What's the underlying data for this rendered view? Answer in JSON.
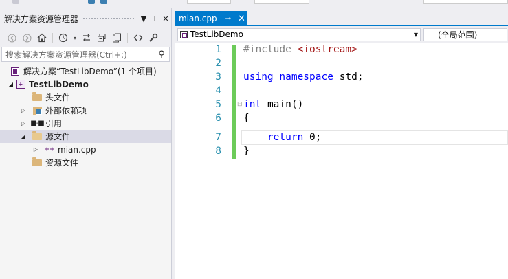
{
  "solution_explorer": {
    "title": "解决方案资源管理器",
    "title_buttons": [
      "▼",
      "⊥",
      "✕"
    ],
    "toolbar_icons": [
      "back-icon",
      "forward-icon",
      "home-icon",
      "history-icon",
      "sync-icon",
      "collapse-icon",
      "show-all-icon",
      "code-icon",
      "properties-icon"
    ],
    "search_placeholder": "搜索解决方案资源管理器(Ctrl+;)",
    "tree": [
      {
        "label": "解决方案“TestLibDemo”(1 个项目)",
        "level": 0,
        "icon": "solution-icon",
        "expand": ""
      },
      {
        "label": "TestLibDemo",
        "level": 0,
        "icon": "project-icon",
        "expand": "◢",
        "bold": true
      },
      {
        "label": "头文件",
        "level": 1,
        "icon": "folder-icon",
        "expand": ""
      },
      {
        "label": "外部依赖项",
        "level": 1,
        "icon": "external-deps-icon",
        "expand": "▷"
      },
      {
        "label": "引用",
        "level": 1,
        "icon": "references-icon",
        "expand": "▷"
      },
      {
        "label": "源文件",
        "level": 1,
        "icon": "folder-open-icon",
        "expand": "◢",
        "selected": true
      },
      {
        "label": "mian.cpp",
        "level": 2,
        "icon": "cpp-file-icon",
        "expand": "▷"
      },
      {
        "label": "资源文件",
        "level": 1,
        "icon": "folder-icon",
        "expand": ""
      }
    ]
  },
  "editor": {
    "tab": {
      "label": "mian.cpp",
      "pin": "⊸",
      "close": "✕"
    },
    "project_dropdown": "TestLibDemo",
    "scope_dropdown": "(全局范围)",
    "lines": [
      {
        "n": "1"
      },
      {
        "n": "2"
      },
      {
        "n": "3"
      },
      {
        "n": "4"
      },
      {
        "n": "5"
      },
      {
        "n": "6"
      },
      {
        "n": "7"
      },
      {
        "n": "8"
      }
    ],
    "code": {
      "l1_directive": "#include",
      "l1_header": "<iostream>",
      "l3_using": "using",
      "l3_namespace": "namespace",
      "l3_rest": "std;",
      "l5_int": "int",
      "l5_rest": "main()",
      "l6": "{",
      "l7_return": "return",
      "l7_rest": "0;",
      "l8": "}"
    }
  },
  "colors": {
    "accent": "#007acc",
    "keyword": "#0000ff",
    "string": "#a31515",
    "preprocessor": "#808080",
    "line_number": "#2b91af",
    "change_bar": "#6ccb59"
  }
}
